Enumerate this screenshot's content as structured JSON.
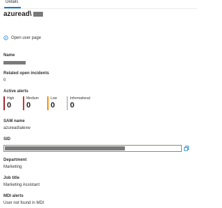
{
  "tabs": [
    {
      "label": "Details"
    }
  ],
  "header": {
    "title": "azuread\\"
  },
  "open_user_page": "Open user page",
  "name": {
    "label": "Name"
  },
  "related_incidents": {
    "label": "Related open incidents",
    "value": "0"
  },
  "active_alerts": {
    "label": "Active alerts",
    "items": [
      {
        "name": "High",
        "count": "0",
        "color": "#a4262c"
      },
      {
        "name": "Medium",
        "count": "0",
        "color": "#d13438"
      },
      {
        "name": "Low",
        "count": "0",
        "color": "#ff8c00"
      },
      {
        "name": "Informational",
        "count": "0",
        "color": "#c8c6c4"
      }
    ]
  },
  "sam_name": {
    "label": "SAM name",
    "value": "azuread\\alexw"
  },
  "sid": {
    "label": "SID"
  },
  "department": {
    "label": "Department",
    "value": "Marketing"
  },
  "job_title": {
    "label": "Job title",
    "value": "Marketing Assistant"
  },
  "mdi_alerts": {
    "label": "MDI alerts",
    "value": "User not found in MDI"
  }
}
